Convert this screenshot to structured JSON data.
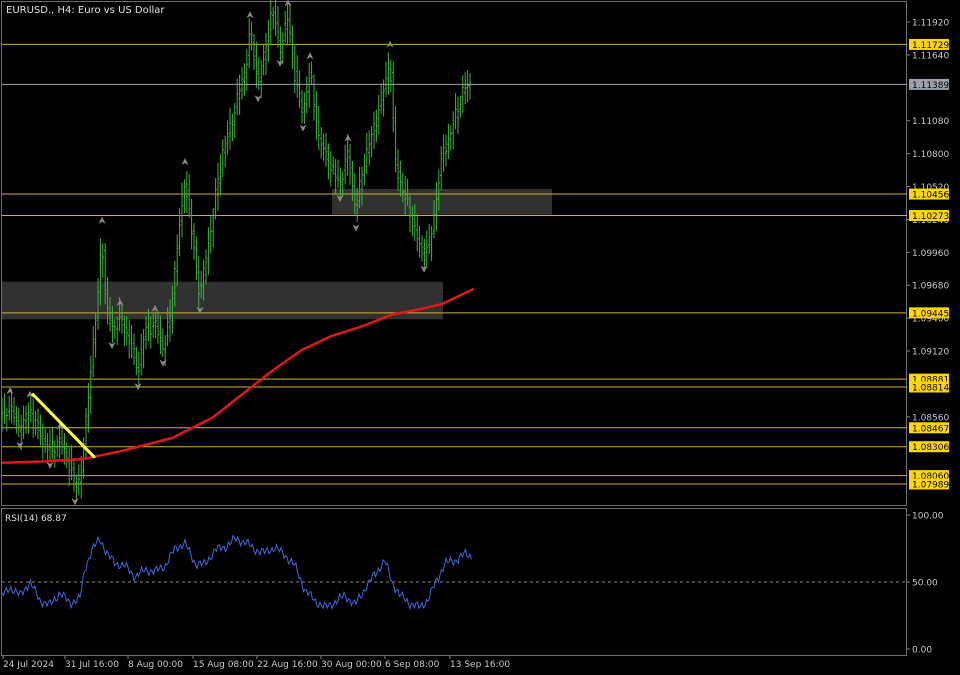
{
  "header": {
    "title": "EURUSD., H4:  Euro vs US Dollar"
  },
  "price_axis": {
    "ticks": [
      "1.11920",
      "1.11640",
      "1.11080",
      "1.10800",
      "1.10520",
      "1.10240",
      "1.09960",
      "1.09680",
      "1.09400",
      "1.09120",
      "1.08560"
    ],
    "current_price": "1.11389"
  },
  "levels": [
    {
      "label": "1.11729",
      "price": 1.11729
    },
    {
      "label": "1.10456",
      "price": 1.10456
    },
    {
      "label": "1.10273",
      "price": 1.10273
    },
    {
      "label": "1.09445",
      "price": 1.09445
    },
    {
      "label": "1.08881",
      "price": 1.08881
    },
    {
      "label": "1.08814",
      "price": 1.08814
    },
    {
      "label": "1.08467",
      "price": 1.08467
    },
    {
      "label": "1.08306",
      "price": 1.08306
    },
    {
      "label": "1.08060",
      "price": 1.0806
    },
    {
      "label": "1.07989",
      "price": 1.07989
    }
  ],
  "rsi": {
    "label": "RSI(14) 68.87",
    "ticks": [
      "100.00",
      "50.00",
      "0.00"
    ]
  },
  "time_axis": {
    "labels": [
      "24 Jul 2024",
      "31 Jul 16:00",
      "8 Aug 00:00",
      "15 Aug 08:00",
      "22 Aug 16:00",
      "30 Aug 00:00",
      "6 Sep 08:00",
      "13 Sep 16:00"
    ]
  },
  "colors": {
    "background": "#000000",
    "candles": "#3cb43c",
    "moving_average": "#e01818",
    "trendline": "#ffff33",
    "levels": "#d4b030",
    "level_label_bg": "#ffd700",
    "rsi_line": "#4169e1"
  },
  "chart_data": {
    "type": "line",
    "title": "EURUSD., H4:  Euro vs US Dollar",
    "symbol": "EURUSD.",
    "timeframe": "H4",
    "x": [
      "24 Jul 2024",
      "31 Jul 16:00",
      "8 Aug 00:00",
      "15 Aug 08:00",
      "22 Aug 16:00",
      "30 Aug 00:00",
      "6 Sep 08:00",
      "13 Sep 16:00"
    ],
    "ylim": [
      1.0781,
      1.1209
    ],
    "price_path": [
      [
        0,
        1.0855
      ],
      [
        10,
        1.0865
      ],
      [
        20,
        1.0845
      ],
      [
        30,
        1.0862
      ],
      [
        40,
        1.084
      ],
      [
        50,
        1.0828
      ],
      [
        60,
        1.0835
      ],
      [
        70,
        1.0815
      ],
      [
        75,
        1.0797
      ],
      [
        80,
        1.0803
      ],
      [
        85,
        1.084
      ],
      [
        92,
        1.091
      ],
      [
        98,
        1.096
      ],
      [
        102,
        1.101
      ],
      [
        106,
        1.095
      ],
      [
        112,
        1.093
      ],
      [
        120,
        1.094
      ],
      [
        130,
        1.092
      ],
      [
        138,
        1.0895
      ],
      [
        145,
        1.093
      ],
      [
        155,
        1.0935
      ],
      [
        163,
        1.0915
      ],
      [
        170,
        1.094
      ],
      [
        177,
        1.1
      ],
      [
        185,
        1.106
      ],
      [
        192,
        1.101
      ],
      [
        200,
        1.096
      ],
      [
        208,
        1.1
      ],
      [
        215,
        1.104
      ],
      [
        222,
        1.108
      ],
      [
        230,
        1.11
      ],
      [
        238,
        1.113
      ],
      [
        245,
        1.115
      ],
      [
        250,
        1.1185
      ],
      [
        258,
        1.114
      ],
      [
        265,
        1.1165
      ],
      [
        272,
        1.1205
      ],
      [
        280,
        1.117
      ],
      [
        288,
        1.1195
      ],
      [
        296,
        1.114
      ],
      [
        303,
        1.1115
      ],
      [
        310,
        1.115
      ],
      [
        318,
        1.1095
      ],
      [
        325,
        1.108
      ],
      [
        332,
        1.1065
      ],
      [
        340,
        1.1055
      ],
      [
        348,
        1.108
      ],
      [
        356,
        1.103
      ],
      [
        363,
        1.107
      ],
      [
        370,
        1.109
      ],
      [
        378,
        1.1115
      ],
      [
        385,
        1.114
      ],
      [
        390,
        1.116
      ],
      [
        395,
        1.1075
      ],
      [
        402,
        1.105
      ],
      [
        410,
        1.103
      ],
      [
        418,
        1.1005
      ],
      [
        424,
        1.0995
      ],
      [
        430,
        1.1005
      ],
      [
        436,
        1.104
      ],
      [
        442,
        1.108
      ],
      [
        450,
        1.1095
      ],
      [
        458,
        1.112
      ],
      [
        464,
        1.1135
      ],
      [
        470,
        1.1139
      ]
    ],
    "series": [
      {
        "values": [
          [
            0,
            1.0817
          ],
          [
            40,
            1.0818
          ],
          [
            80,
            1.082
          ],
          [
            120,
            1.0827
          ],
          [
            170,
            1.0838
          ],
          [
            210,
            1.0855
          ],
          [
            240,
            1.0875
          ],
          [
            270,
            1.0895
          ],
          [
            300,
            1.0913
          ],
          [
            330,
            1.0925
          ],
          [
            360,
            1.0933
          ],
          [
            390,
            1.0943
          ],
          [
            420,
            1.0948
          ],
          [
            440,
            1.0952
          ],
          [
            472,
            1.0965
          ]
        ]
      }
    ],
    "trendline": [
      [
        33,
        1.0875
      ],
      [
        94,
        1.0822
      ]
    ],
    "zones": [
      {
        "x_start": 0,
        "x_end": 441,
        "y_low": 1.0939,
        "y_high": 1.0971
      },
      {
        "x_start": 330,
        "x_end": 550,
        "y_low": 1.1028,
        "y_high": 1.105
      }
    ],
    "rsi": {
      "name": "RSI(14)",
      "last": 68.87,
      "ylim": [
        0,
        100
      ],
      "level": 50,
      "values": [
        [
          0,
          38
        ],
        [
          10,
          46
        ],
        [
          20,
          40
        ],
        [
          30,
          50
        ],
        [
          40,
          36
        ],
        [
          50,
          33
        ],
        [
          60,
          42
        ],
        [
          70,
          34
        ],
        [
          80,
          38
        ],
        [
          85,
          60
        ],
        [
          92,
          74
        ],
        [
          100,
          82
        ],
        [
          108,
          70
        ],
        [
          115,
          64
        ],
        [
          125,
          62
        ],
        [
          135,
          54
        ],
        [
          145,
          59
        ],
        [
          155,
          58
        ],
        [
          165,
          62
        ],
        [
          175,
          75
        ],
        [
          185,
          79
        ],
        [
          195,
          64
        ],
        [
          205,
          63
        ],
        [
          215,
          74
        ],
        [
          225,
          76
        ],
        [
          235,
          82
        ],
        [
          245,
          80
        ],
        [
          255,
          74
        ],
        [
          265,
          72
        ],
        [
          275,
          76
        ],
        [
          285,
          70
        ],
        [
          295,
          62
        ],
        [
          305,
          44
        ],
        [
          315,
          36
        ],
        [
          325,
          31
        ],
        [
          335,
          35
        ],
        [
          345,
          40
        ],
        [
          355,
          33
        ],
        [
          365,
          45
        ],
        [
          375,
          56
        ],
        [
          385,
          66
        ],
        [
          392,
          50
        ],
        [
          400,
          40
        ],
        [
          410,
          34
        ],
        [
          420,
          31
        ],
        [
          428,
          37
        ],
        [
          436,
          50
        ],
        [
          445,
          64
        ],
        [
          455,
          66
        ],
        [
          465,
          71
        ],
        [
          472,
          69
        ]
      ]
    }
  }
}
